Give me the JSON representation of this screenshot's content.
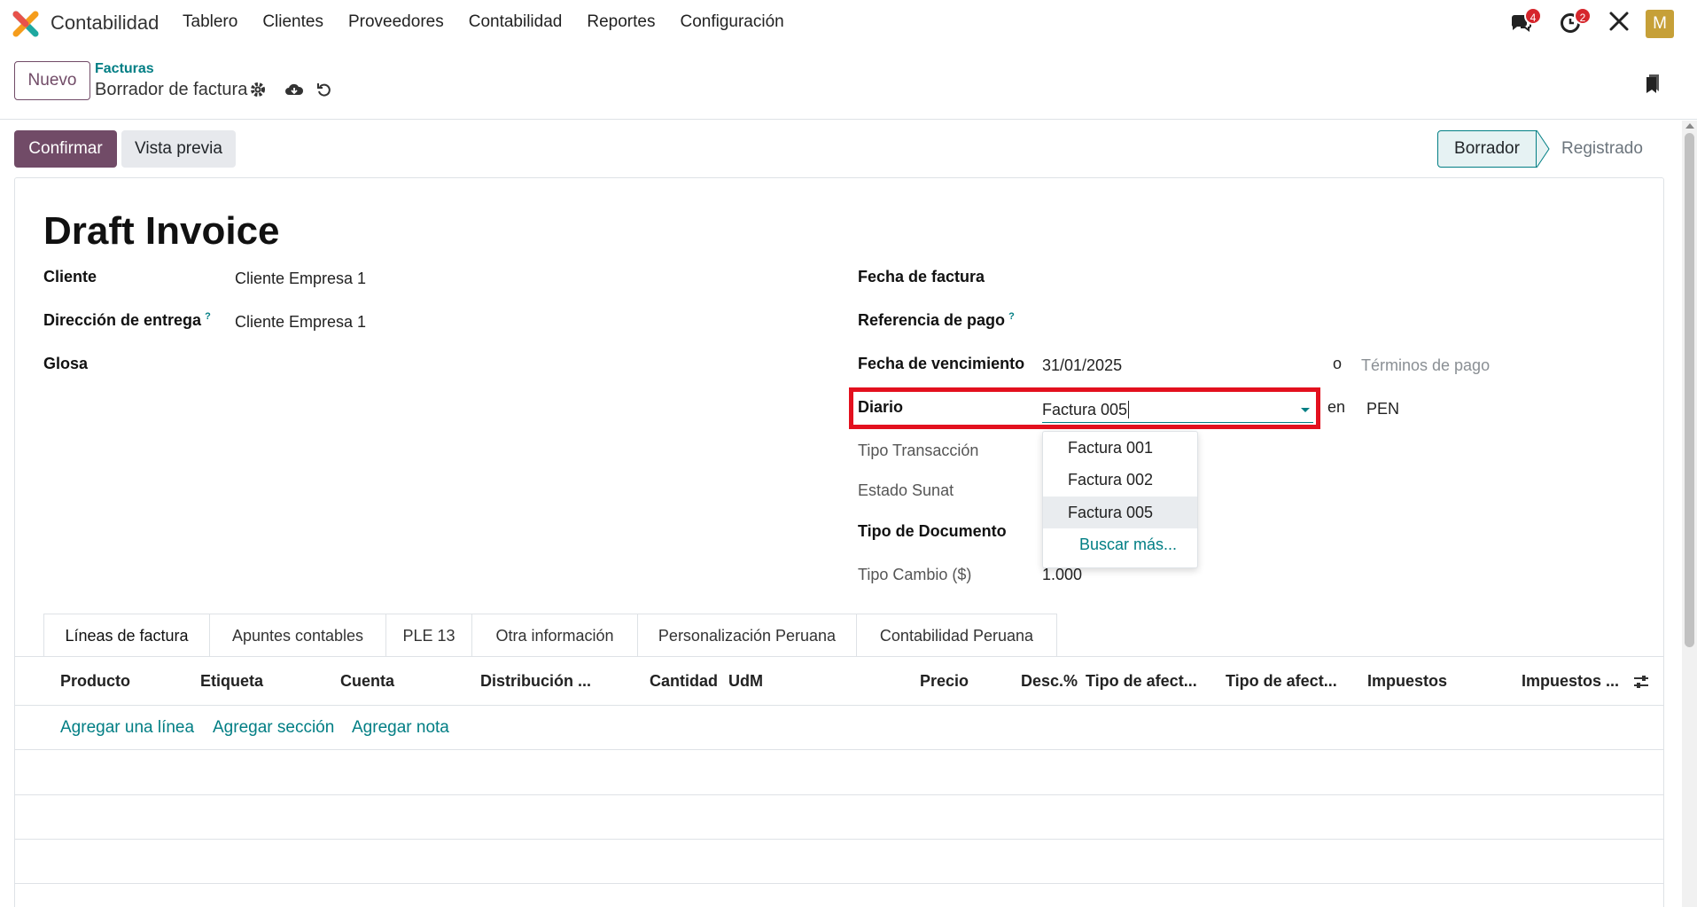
{
  "navbar": {
    "app_name": "Contabilidad",
    "menu": [
      "Tablero",
      "Clientes",
      "Proveedores",
      "Contabilidad",
      "Reportes",
      "Configuración"
    ],
    "messages_count": "4",
    "activities_count": "2",
    "avatar_letter": "M"
  },
  "control_panel": {
    "new_label": "Nuevo",
    "breadcrumb": "Facturas",
    "record_title": "Borrador de factura"
  },
  "status_bar": {
    "confirm_label": "Confirmar",
    "preview_label": "Vista previa",
    "stage_current": "Borrador",
    "stage_next": "Registrado"
  },
  "form": {
    "title": "Draft Invoice",
    "left": {
      "customer_label": "Cliente",
      "customer_value": "Cliente Empresa 1",
      "delivery_label": "Dirección de entrega",
      "delivery_value": "Cliente Empresa 1",
      "glosa_label": "Glosa"
    },
    "right": {
      "invoice_date_label": "Fecha de factura",
      "payment_ref_label": "Referencia de pago",
      "due_date_label": "Fecha de vencimiento",
      "due_date_value": "31/01/2025",
      "or_text": "o",
      "payment_terms_placeholder": "Términos de pago",
      "journal_label": "Diario",
      "journal_value": "Factura 005",
      "in_text": "en",
      "currency": "PEN",
      "transaction_type_label": "Tipo Transacción",
      "sunat_status_label": "Estado Sunat",
      "document_type_label": "Tipo de Documento",
      "exchange_rate_label": "Tipo Cambio ($)",
      "exchange_rate_value": "1.000"
    },
    "journal_dropdown": [
      "Factura 001",
      "Factura 002",
      "Factura 005"
    ],
    "journal_dropdown_selected": "Factura 005",
    "journal_search_more": "Buscar más..."
  },
  "tabs": [
    "Líneas de factura",
    "Apuntes contables",
    "PLE 13",
    "Otra información",
    "Personalización Peruana",
    "Contabilidad Peruana"
  ],
  "table": {
    "columns": [
      "Producto",
      "Etiqueta",
      "Cuenta",
      "Distribución ...",
      "Cantidad",
      "UdM",
      "Precio",
      "Desc.%",
      "Tipo de afect...",
      "Tipo de afect...",
      "Impuestos",
      "Impuestos ..."
    ],
    "add_line": "Agregar una línea",
    "add_section": "Agregar sección",
    "add_note": "Agregar nota"
  },
  "colors": {
    "primary": "#714b67",
    "link": "#017e84",
    "highlight": "#e3101e"
  }
}
